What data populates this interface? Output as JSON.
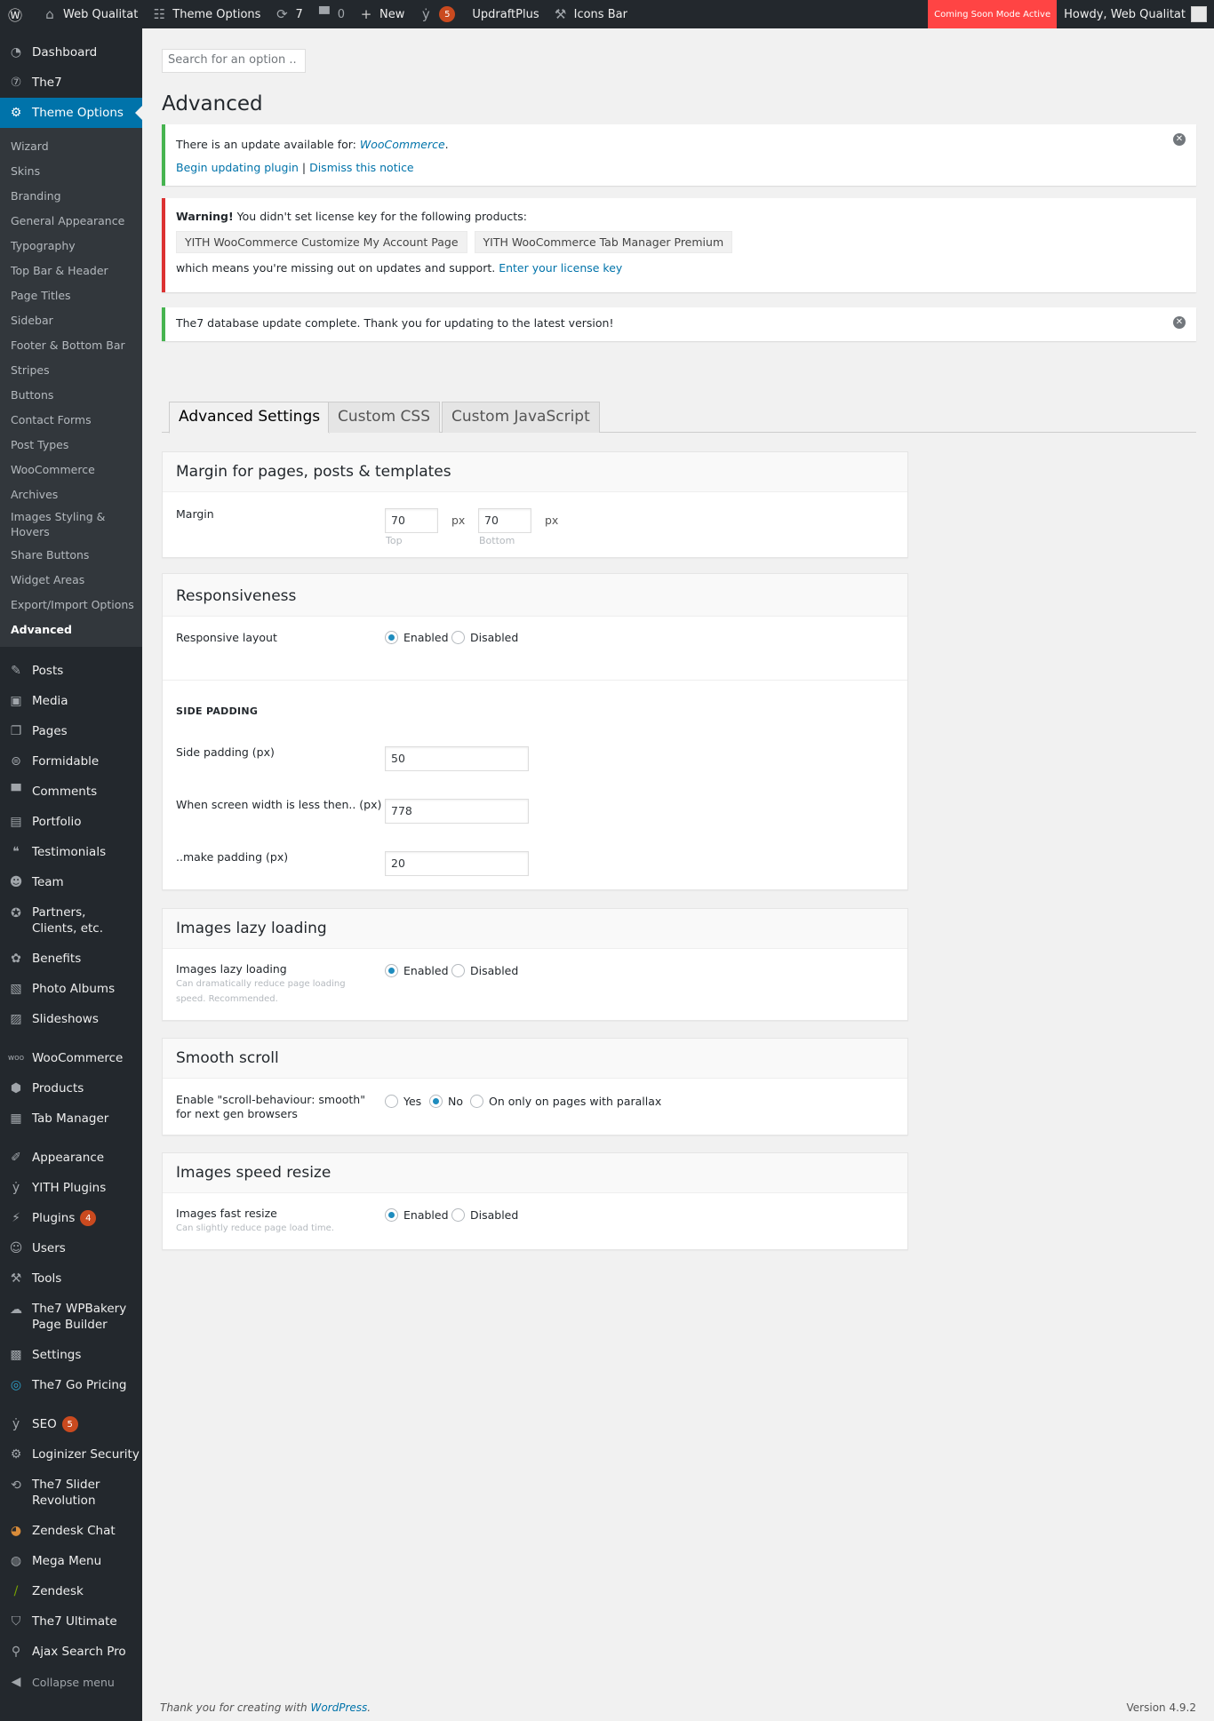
{
  "adminbar": {
    "site_name": "Web Qualitat",
    "theme_options": "Theme Options",
    "updates_count": "7",
    "comments_count": "0",
    "new_label": "New",
    "seo_badge": "5",
    "updraft": "UpdraftPlus",
    "icons_bar": "Icons Bar",
    "coming_soon": "Coming Soon Mode Active",
    "howdy": "Howdy, Web Qualitat"
  },
  "sidebar": {
    "dashboard": "Dashboard",
    "the7": "The7",
    "theme_options": "Theme Options",
    "submenu": [
      "Wizard",
      "Skins",
      "Branding",
      "General Appearance",
      "Typography",
      "Top Bar & Header",
      "Page Titles",
      "Sidebar",
      "Footer & Bottom Bar",
      "Stripes",
      "Buttons",
      "Contact Forms",
      "Post Types",
      "WooCommerce",
      "Archives",
      "Images Styling & Hovers",
      "Share Buttons",
      "Widget Areas",
      "Export/Import Options",
      "Advanced"
    ],
    "group1": [
      "Posts",
      "Media",
      "Pages",
      "Formidable",
      "Comments",
      "Portfolio",
      "Testimonials",
      "Team",
      "Partners, Clients, etc.",
      "Benefits",
      "Photo Albums",
      "Slideshows"
    ],
    "group2": [
      "WooCommerce",
      "Products",
      "Tab Manager"
    ],
    "group3": [
      "Appearance",
      "YITH Plugins",
      "Plugins",
      "Users",
      "Tools",
      "The7 WPBakery Page Builder",
      "Settings",
      "The7 Go Pricing"
    ],
    "plugins_badge": "4",
    "group4": [
      "SEO",
      "Loginizer Security",
      "The7 Slider Revolution",
      "Zendesk Chat",
      "Mega Menu",
      "Zendesk",
      "The7 Ultimate",
      "Ajax Search Pro"
    ],
    "seo_badge": "5",
    "collapse": "Collapse menu"
  },
  "search": {
    "placeholder": "Search for an option .."
  },
  "page_title": "Advanced",
  "notices": {
    "update_text": "There is an update available for:",
    "update_link": "WooCommerce",
    "update_dot": ".",
    "begin_link": "Begin updating plugin",
    "sep": "|",
    "dismiss_link": "Dismiss this notice",
    "warning_bold": "Warning!",
    "warning_text": "You didn't set license key for the following products:",
    "product1": "YITH WooCommerce Customize My Account Page",
    "product2": "YITH WooCommerce Tab Manager Premium",
    "missing_text": "which means you're missing out on updates and support.",
    "license_link": "Enter your license key",
    "db_text": "The7 database update complete. Thank you for updating to the latest version!"
  },
  "tabs": [
    "Advanced Settings",
    "Custom CSS",
    "Custom JavaScript"
  ],
  "margin_box": {
    "title": "Margin for pages, posts & templates",
    "label": "Margin",
    "top_value": "70",
    "bottom_value": "70",
    "unit": "px",
    "top_label": "Top",
    "bottom_label": "Bottom"
  },
  "responsive_box": {
    "title": "Responsiveness",
    "layout_label": "Responsive layout",
    "enabled": "Enabled",
    "disabled": "Disabled",
    "side_padding_head": "SIDE PADDING",
    "side_padding_label": "Side padding (px)",
    "side_padding_value": "50",
    "width_label": "When screen width is less then.. (px)",
    "width_value": "778",
    "make_label": "..make padding (px)",
    "make_value": "20"
  },
  "lazy_box": {
    "title": "Images lazy loading",
    "label": "Images lazy loading",
    "desc": "Can dramatically reduce page loading speed. Recommended.",
    "enabled": "Enabled",
    "disabled": "Disabled"
  },
  "smooth_box": {
    "title": "Smooth scroll",
    "label": "Enable \"scroll-behaviour: smooth\" for next gen browsers",
    "yes": "Yes",
    "no": "No",
    "parallax": "On only on pages with parallax"
  },
  "resize_box": {
    "title": "Images speed resize",
    "label": "Images fast resize",
    "desc": "Can slightly reduce page load time.",
    "enabled": "Enabled",
    "disabled": "Disabled"
  },
  "footer": {
    "thanks": "Thank you for creating with",
    "wp_link": "WordPress",
    "dot": ".",
    "version": "Version 4.9.2"
  },
  "colors": {
    "accent": "#0073aa",
    "adminbar": "#23282d",
    "coming_soon": "#ff4444",
    "badge": "#ca4a1f"
  }
}
